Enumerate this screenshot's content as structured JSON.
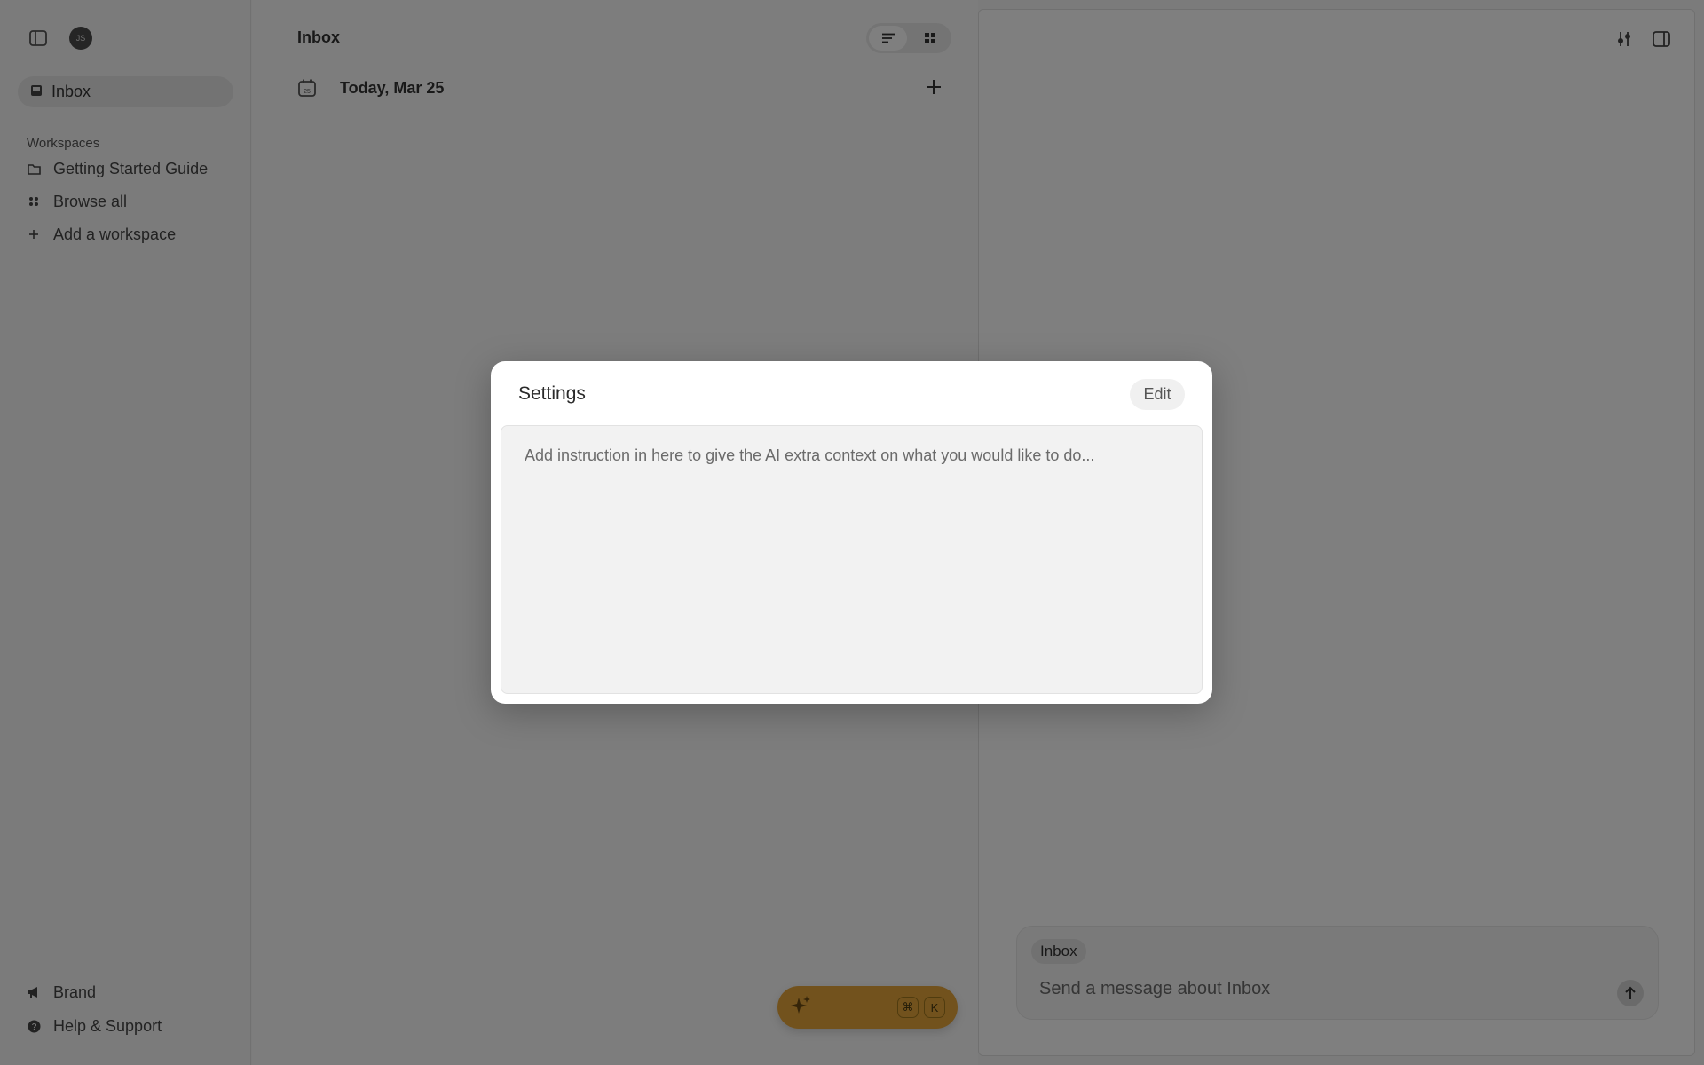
{
  "sidebar": {
    "avatar_initials": "JS",
    "inbox_label": "Inbox",
    "workspaces_heading": "Workspaces",
    "items": [
      {
        "label": "Getting Started Guide",
        "icon": "folder-icon"
      },
      {
        "label": "Browse all",
        "icon": "grid-dots-icon"
      },
      {
        "label": "Add a workspace",
        "icon": "plus-icon"
      }
    ],
    "bottom": [
      {
        "label": "Brand",
        "icon": "megaphone-icon"
      },
      {
        "label": "Help & Support",
        "icon": "help-circle-icon"
      }
    ]
  },
  "middle": {
    "title": "Inbox",
    "date_label": "Today, Mar 25",
    "calendar_day": "25",
    "shortcut_keys": [
      "⌘",
      "K"
    ]
  },
  "right": {
    "chip_label": "Inbox",
    "chat_placeholder": "Send a message about Inbox"
  },
  "modal": {
    "title": "Settings",
    "edit_label": "Edit",
    "placeholder": "Add instruction in here to give the AI extra context on what you would like to do..."
  },
  "colors": {
    "accent": "#e4a43b",
    "overlay": "#00000080"
  }
}
